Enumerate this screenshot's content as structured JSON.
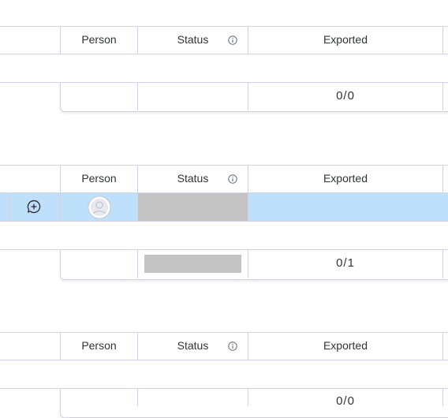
{
  "groups": [
    {
      "columns": {
        "person": "Person",
        "status": "Status",
        "exported": "Exported"
      },
      "summary": {
        "exported_count": "0/0"
      }
    },
    {
      "columns": {
        "person": "Person",
        "status": "Status",
        "exported": "Exported"
      },
      "summary": {
        "exported_count": "0/1"
      }
    },
    {
      "columns": {
        "person": "Person",
        "status": "Status",
        "exported": "Exported"
      },
      "summary": {
        "exported_count": "0/0"
      }
    }
  ],
  "colors": {
    "grid_line": "#d0d4e4",
    "selected_row": "#bfe0fb",
    "empty_status": "#c4c4c4"
  }
}
